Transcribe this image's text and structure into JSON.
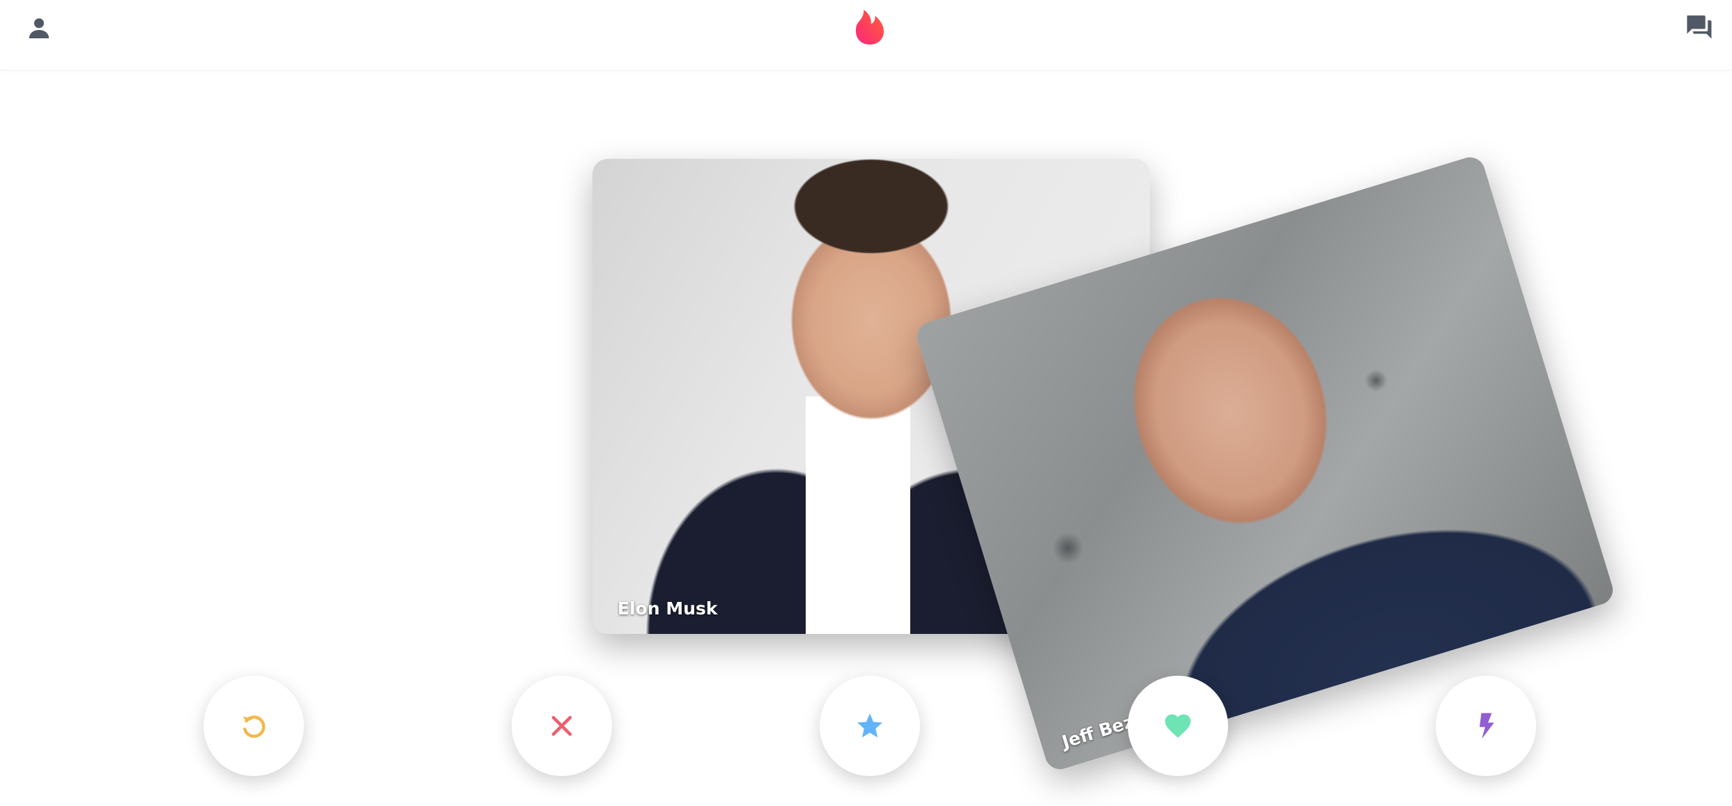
{
  "header": {
    "profile_icon": "person-icon",
    "logo_icon": "flame-logo",
    "messages_icon": "forum-chat-icon"
  },
  "cards": [
    {
      "name": "Elon Musk"
    },
    {
      "name": "Jeff Bezos"
    }
  ],
  "actions": [
    {
      "icon": "rewind-icon",
      "color": "#f5b748"
    },
    {
      "icon": "close-icon",
      "color": "#ec5e6f"
    },
    {
      "icon": "star-icon",
      "color": "#62b4f9"
    },
    {
      "icon": "heart-icon",
      "color": "#6ee3b4"
    },
    {
      "icon": "lightning-icon",
      "color": "#915dd1"
    }
  ],
  "colors": {
    "brand_gradient_start": "#fd267a",
    "brand_gradient_end": "#ff6036",
    "header_icon": "#505965"
  }
}
